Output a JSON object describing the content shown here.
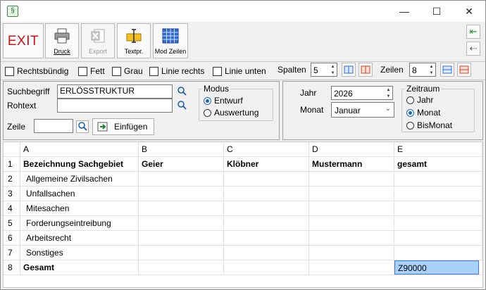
{
  "window": {
    "app_icon_glyph": "§",
    "min_glyph": "—",
    "max_glyph": "☐",
    "close_glyph": "✕"
  },
  "toolbar": {
    "exit_label": "EXIT",
    "druck_label": "Druck",
    "export_label": "Export",
    "textpr_label": "Textpr.",
    "modzeilen_label": "Mod Zeilen",
    "nav_first_glyph": "⇤",
    "nav_prev_glyph": "⇠"
  },
  "options": {
    "rechtsbuendig": "Rechtsbündig",
    "fett": "Fett",
    "grau": "Grau",
    "linie_rechts": "Linie rechts",
    "linie_unten": "Linie unten",
    "spalten_label": "Spalten",
    "spalten_value": "5",
    "zeilen_label": "Zeilen",
    "zeilen_value": "8"
  },
  "search": {
    "suchbegriff_label": "Suchbegriff",
    "suchbegriff_value": "ERLÖSSTRUKTUR",
    "rohtext_label": "Rohtext",
    "rohtext_value": "",
    "zeile_label": "Zeile",
    "zeile_value": "",
    "einfuegen_label": "Einfügen"
  },
  "modus": {
    "title": "Modus",
    "options": [
      "Entwurf",
      "Auswertung"
    ],
    "selected": "Entwurf"
  },
  "period": {
    "jahr_label": "Jahr",
    "jahr_value": "2026",
    "monat_label": "Monat",
    "monat_value": "Januar",
    "zeitraum_title": "Zeitraum",
    "zeitraum_options": [
      "Jahr",
      "Monat",
      "BisMonat"
    ],
    "zeitraum_selected": "Monat"
  },
  "grid": {
    "columns": [
      "",
      "A",
      "B",
      "C",
      "D",
      "E"
    ],
    "rows": [
      [
        "1",
        "Bezeichnung Sachgebiet",
        "Geier",
        "Klöbner",
        "Mustermann",
        "gesamt"
      ],
      [
        "2",
        "Allgemeine Zivilsachen",
        "",
        "",
        "",
        ""
      ],
      [
        "3",
        "Unfallsachen",
        "",
        "",
        "",
        ""
      ],
      [
        "4",
        "Mitesachen",
        "",
        "",
        "",
        ""
      ],
      [
        "5",
        "Forderungseintreibung",
        "",
        "",
        "",
        ""
      ],
      [
        "6",
        "Arbeitsrecht",
        "",
        "",
        "",
        ""
      ],
      [
        "7",
        "Sonstiges",
        "",
        "",
        "",
        ""
      ],
      [
        "8",
        "Gesamt",
        "",
        "",
        "",
        "Z90000"
      ]
    ],
    "selected_cell": "E8"
  },
  "colors": {
    "exit_red": "#d0101a",
    "radio_blue": "#1b64c8",
    "selection": "#a8d0f8"
  }
}
